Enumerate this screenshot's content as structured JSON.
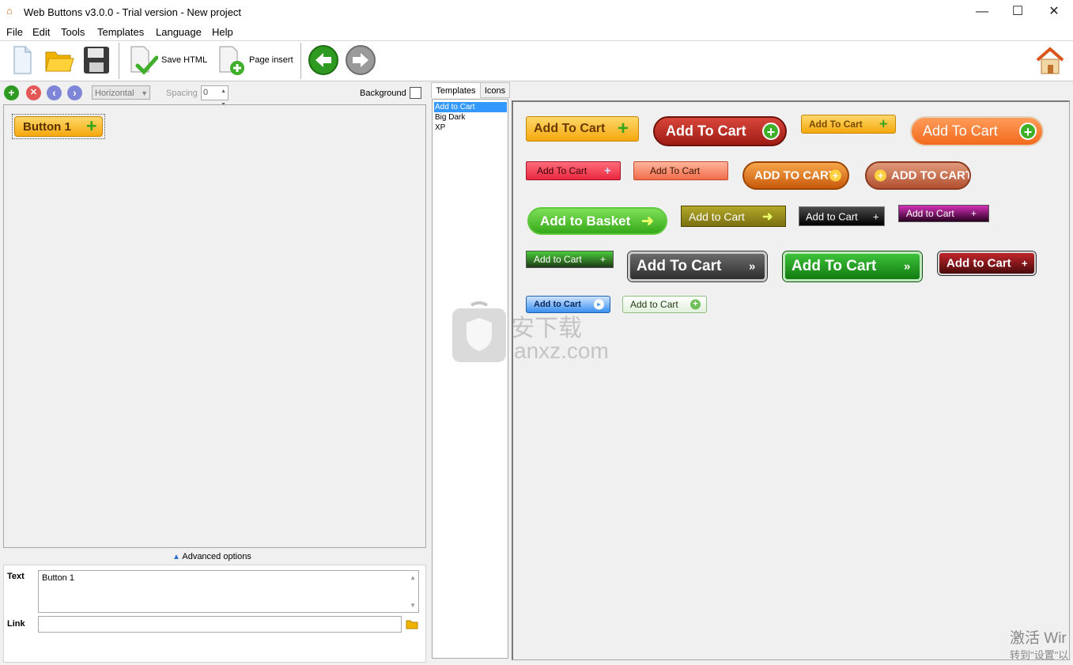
{
  "window": {
    "title": "Web Buttons v3.0.0 - Trial version - New project",
    "minimize": "—",
    "maximize": "☐",
    "close": "✕"
  },
  "menu": [
    "File",
    "Edit",
    "Tools",
    "Templates",
    "Language",
    "Help"
  ],
  "toolbar": {
    "icons": [
      "new-page-icon",
      "open-folder-icon",
      "save-disk-icon",
      "save-html-icon",
      "page-insert-icon",
      "back-icon",
      "forward-icon",
      "home-icon"
    ],
    "save_html": "Save HTML",
    "page_insert": "Page insert"
  },
  "controls": {
    "orientation": "Horizontal",
    "spacing_label": "Spacing",
    "spacing_value": "0",
    "background_label": "Background"
  },
  "canvas": {
    "button_label": "Button 1"
  },
  "advanced": "Advanced options",
  "properties": {
    "text_label": "Text",
    "text_value": "Button 1",
    "link_label": "Link",
    "link_value": ""
  },
  "tabs": [
    "Templates",
    "Icons"
  ],
  "template_list": [
    "Add to Cart",
    "Big Dark",
    "XP"
  ],
  "selected_template": "Add to Cart",
  "preview_buttons": [
    "Add To Cart",
    "Add To Cart",
    "Add To Cart",
    "Add To Cart",
    "Add To Cart",
    "Add To Cart",
    "ADD TO CART",
    "ADD TO CART",
    "Add to Basket",
    "Add to Cart",
    "Add to Cart",
    "Add to Cart",
    "Add to Cart",
    "Add To Cart",
    "Add To Cart",
    "Add to Cart",
    "Add to Cart",
    "Add to Cart"
  ],
  "watermark": {
    "cn": "安下载",
    "site": "anxz.com"
  },
  "activation": {
    "line1": "激活 Wir",
    "line2": "转到\"设置\"以"
  },
  "colors": {
    "accent_select": "#3399ff",
    "orange": "#f5a80e",
    "green": "#37a51c"
  }
}
